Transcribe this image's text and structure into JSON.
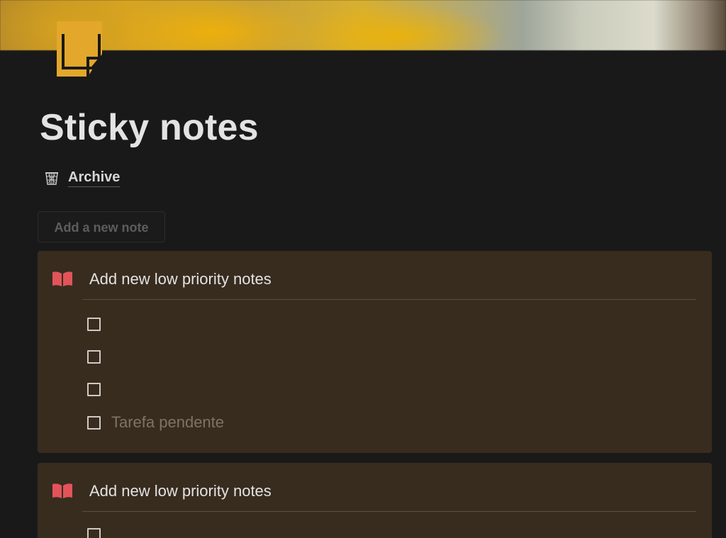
{
  "page": {
    "title": "Sticky notes",
    "icon": "sticky-note-icon",
    "cover": "blurred-yellow-photo-cover"
  },
  "archive_link": {
    "label": "Archive",
    "icon": "basket-icon"
  },
  "add_note_button": {
    "label": "Add a new note"
  },
  "notes": [
    {
      "title": "Add new low priority notes",
      "icon": "open-book-icon",
      "todos": [
        {
          "text": "",
          "checked": false
        },
        {
          "text": "",
          "checked": false
        },
        {
          "text": "",
          "checked": false
        },
        {
          "text": "Tarefa pendente",
          "checked": false
        }
      ]
    },
    {
      "title": "Add new low priority notes",
      "icon": "open-book-icon",
      "todos": [
        {
          "text": "",
          "checked": false
        }
      ]
    }
  ],
  "colors": {
    "background": "#191919",
    "card_background": "#382c1f",
    "accent_yellow": "#e2a72b",
    "book_red": "#e2545a",
    "text_primary": "#e3e3e3",
    "text_placeholder": "#7f7366"
  }
}
